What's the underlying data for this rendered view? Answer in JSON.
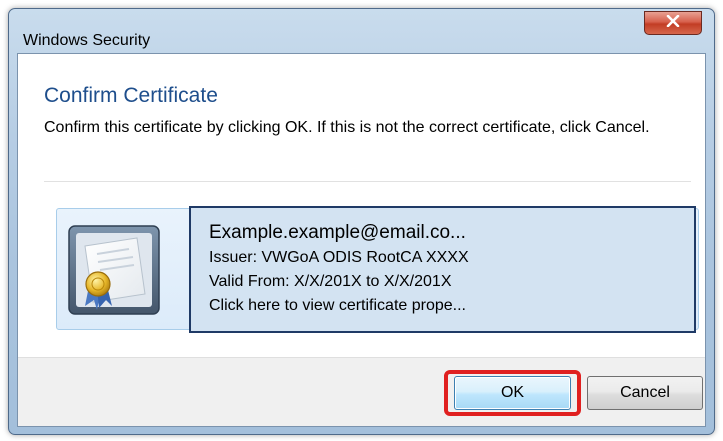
{
  "window": {
    "title": "Windows Security"
  },
  "dialog": {
    "heading": "Confirm Certificate",
    "instruction": "Confirm this certificate by clicking OK. If this is not the correct certificate, click Cancel."
  },
  "certificate": {
    "name": "Example.example@email.co...",
    "issuer": "Issuer: VWGoA ODIS RootCA XXXX",
    "valid": "Valid From: X/X/201X to X/X/201X",
    "link": "Click here to view certificate prope..."
  },
  "buttons": {
    "ok": "OK",
    "cancel": "Cancel"
  },
  "colors": {
    "heading": "#1e4e8c",
    "highlight": "#e02020",
    "close": "#c23d24"
  }
}
